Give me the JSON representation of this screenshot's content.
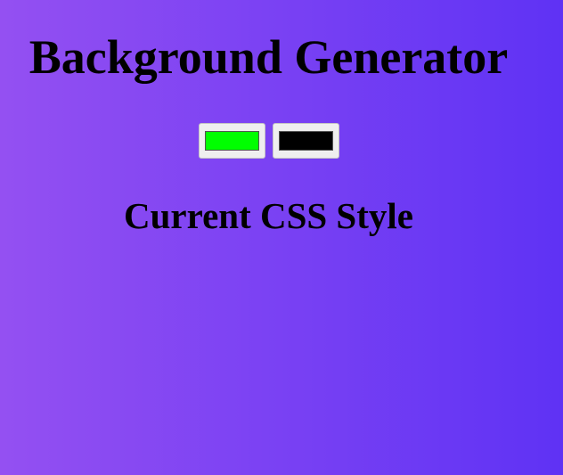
{
  "page": {
    "title": "Background Generator",
    "subtitle": "Current CSS Style"
  },
  "pickers": {
    "color1": "#00ff00",
    "color2": "#000000"
  },
  "colors": {
    "gradient_left": "#9450f2",
    "gradient_right": "#5f32f4"
  }
}
